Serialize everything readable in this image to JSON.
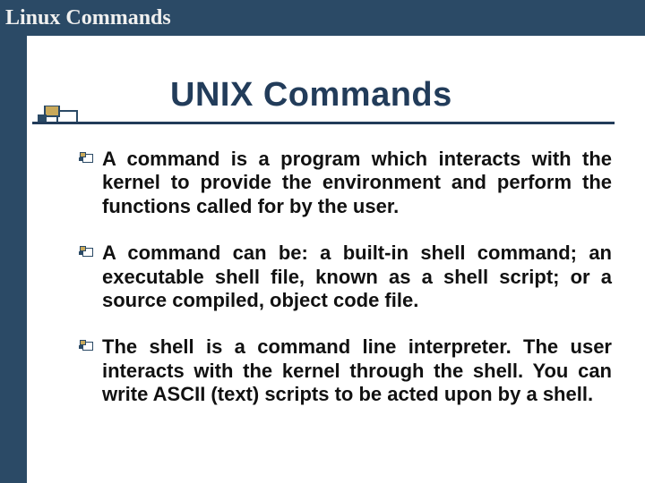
{
  "header": {
    "title": "Linux Commands"
  },
  "slide": {
    "title": "UNIX Commands",
    "bullets": [
      "A command is a program which interacts with the kernel to provide the environment and perform the functions called for by the user.",
      "A command can be: a built-in shell command; an executable shell file, known as a shell script; or a source compiled, object code file.",
      "The shell is a command line interpreter. The user interacts with the kernel through the shell. You can write ASCII (text) scripts to be acted upon by a shell."
    ]
  }
}
